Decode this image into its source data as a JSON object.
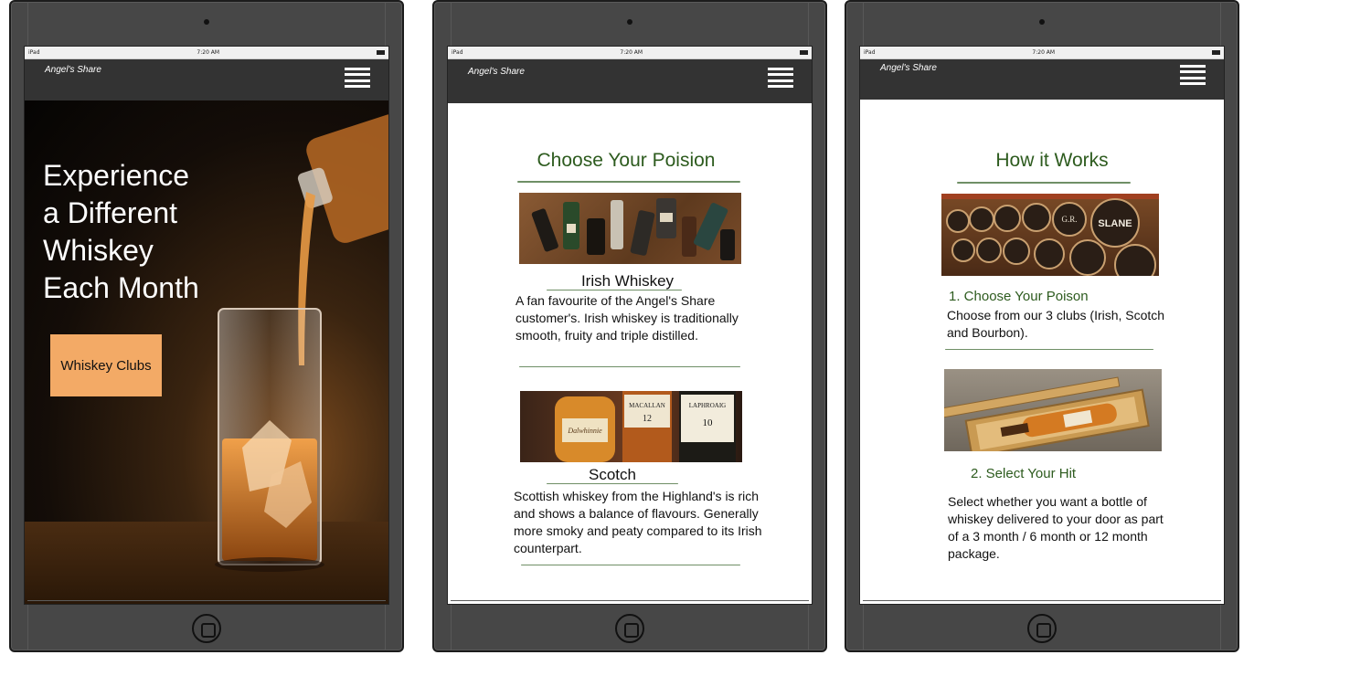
{
  "status": {
    "device": "iPad",
    "time": "7:20 AM"
  },
  "brand": "Angel's Share",
  "home": {
    "hero_title": [
      "Experience",
      "a Different",
      "Whiskey",
      "Each Month"
    ],
    "cta_label": "Whiskey Clubs"
  },
  "clubs": {
    "title": "Choose Your Poision",
    "items": [
      {
        "name": "Irish Whiskey",
        "description": "A fan favourite of the Angel's Share customer's. Irish whiskey is traditionally smooth, fruity and triple distilled."
      },
      {
        "name": "Scotch",
        "description": "Scottish whiskey from the Highland's is rich and shows a balance of flavours. Generally more smoky and peaty compared to its Irish counterpart."
      }
    ],
    "bottle_labels": [
      "Dalwhinnie",
      "MACALLAN",
      "12",
      "LAPHROAIG",
      "10"
    ]
  },
  "how": {
    "title": "How it Works",
    "steps": [
      {
        "title": "1. Choose Your Poison",
        "text": "Choose from our 3 clubs (Irish, Scotch and Bourbon)."
      },
      {
        "title": "2. Select Your Hit",
        "text": "Select whether you want a bottle of whiskey delivered to your door as part of a 3 month / 6 month or 12 month package."
      }
    ],
    "barrel_labels": [
      "G.R.",
      "SLANE"
    ]
  },
  "colors": {
    "accent_green": "#2d5b1e",
    "cta_orange": "#f3aa66",
    "navbar": "#333333"
  }
}
